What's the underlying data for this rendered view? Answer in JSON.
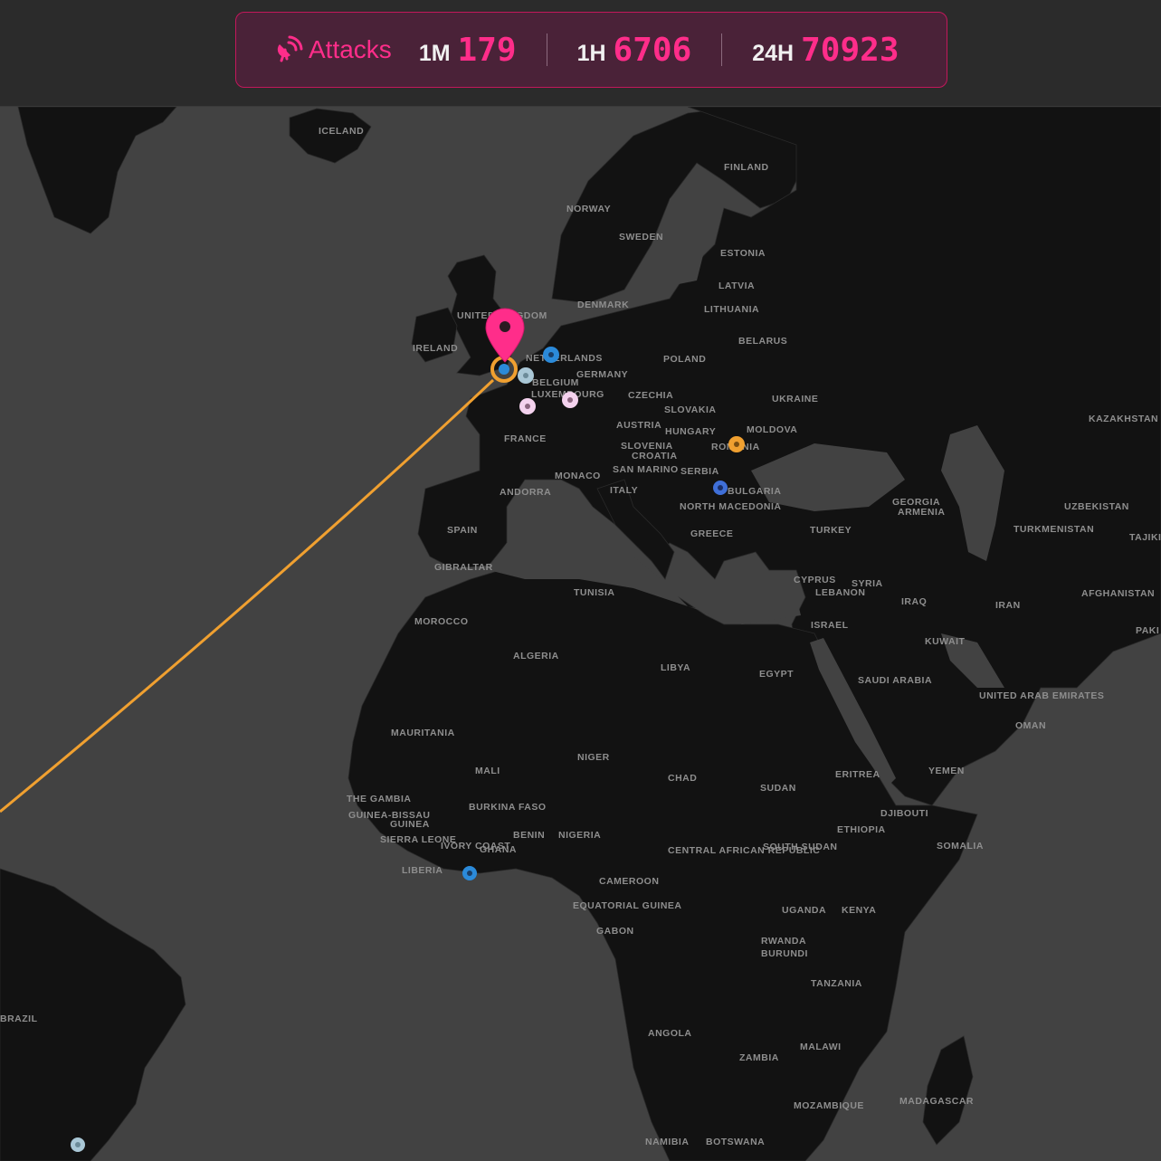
{
  "header": {
    "title": "Attacks",
    "stats": [
      {
        "label": "1M",
        "value": "179"
      },
      {
        "label": "1H",
        "value": "6706"
      },
      {
        "label": "24H",
        "value": "70923"
      }
    ]
  },
  "colors": {
    "accent": "#ff2d8a",
    "panel_bg": "#4a2238",
    "land": "#121212",
    "sea": "#424242",
    "arc": "#f0a030"
  },
  "icons": {
    "brand_icon": "satellite-dish-icon",
    "location_icon": "map-pin-icon"
  },
  "map_labels": [
    "ICELAND",
    "FINLAND",
    "NORWAY",
    "SWEDEN",
    "ESTONIA",
    "LATVIA",
    "LITHUANIA",
    "DENMARK",
    "UNITED KINGDOM",
    "IRELAND",
    "BELARUS",
    "POLAND",
    "NETHERLANDS",
    "GERMANY",
    "BELGIUM",
    "LUXEMBOURG",
    "CZECHIA",
    "UKRAINE",
    "SLOVAKIA",
    "KAZAKHSTAN",
    "AUSTRIA",
    "HUNGARY",
    "MOLDOVA",
    "FRANCE",
    "SLOVENIA",
    "CROATIA",
    "ROMANIA",
    "SAN MARINO",
    "MONACO",
    "SERBIA",
    "ANDORRA",
    "ITALY",
    "BULGARIA",
    "NORTH MACEDONIA",
    "GEORGIA",
    "ARMENIA",
    "UZBEKISTAN",
    "SPAIN",
    "TURKEY",
    "TURKMENISTAN",
    "TAJIKI",
    "GREECE",
    "GIBRALTAR",
    "CYPRUS",
    "SYRIA",
    "LEBANON",
    "TUNISIA",
    "AFGHANISTAN",
    "IRAQ",
    "IRAN",
    "MOROCCO",
    "ISRAEL",
    "PAKI",
    "KUWAIT",
    "ALGERIA",
    "LIBYA",
    "EGYPT",
    "SAUDI ARABIA",
    "UNITED ARAB EMIRATES",
    "OMAN",
    "MAURITANIA",
    "NIGER",
    "MALI",
    "CHAD",
    "SUDAN",
    "ERITREA",
    "YEMEN",
    "THE GAMBIA",
    "GUINEA-BISSAU",
    "BURKINA FASO",
    "DJIBOUTI",
    "GUINEA",
    "BENIN",
    "NIGERIA",
    "ETHIOPIA",
    "SIERRA LEONE",
    "IVORY COAST",
    "GHANA",
    "CENTRAL AFRICAN REPUBLIC",
    "SOUTH SUDAN",
    "SOMALIA",
    "LIBERIA",
    "CAMEROON",
    "EQUATORIAL GUINEA",
    "GABON",
    "UGANDA",
    "KENYA",
    "RWANDA",
    "BURUNDI",
    "BRAZIL",
    "TANZANIA",
    "ANGOLA",
    "MALAWI",
    "ZAMBIA",
    "MOZAMBIQUE",
    "MADAGASCAR",
    "NAMIBIA",
    "BOTSWANA"
  ]
}
